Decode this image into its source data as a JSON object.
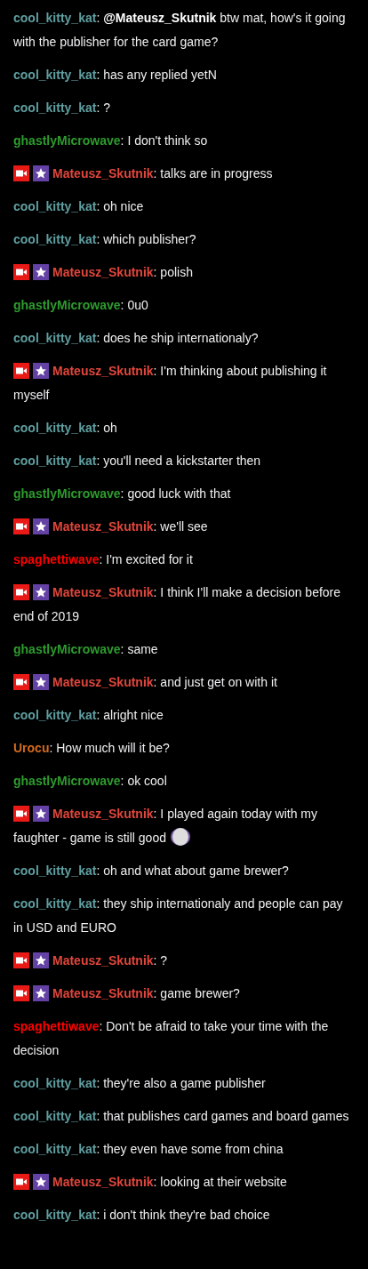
{
  "messages": [
    {
      "author": "cool_kitty_kat",
      "color": "#5f9ea0",
      "text": ": **@Mateusz_Skutnik** btw mat, how's it going with the publisher for the card game?"
    },
    {
      "author": "cool_kitty_kat",
      "color": "#5f9ea0",
      "text": ": has any replied yetN"
    },
    {
      "author": "cool_kitty_kat",
      "color": "#5f9ea0",
      "text": ": ?"
    },
    {
      "author": "ghastlyMicrowave",
      "color": "#2e9b2e",
      "text": ": I don't think so"
    },
    {
      "author": "Mateusz_Skutnik",
      "color": "#e0463c",
      "badges": [
        {
          "kind": "broadcaster"
        },
        {
          "kind": "star"
        }
      ],
      "text": ": talks are in progress"
    },
    {
      "author": "cool_kitty_kat",
      "color": "#5f9ea0",
      "text": ": oh nice"
    },
    {
      "author": "cool_kitty_kat",
      "color": "#5f9ea0",
      "text": ": which publisher?"
    },
    {
      "author": "Mateusz_Skutnik",
      "color": "#e0463c",
      "badges": [
        {
          "kind": "broadcaster"
        },
        {
          "kind": "star"
        }
      ],
      "text": ": polish"
    },
    {
      "author": "ghastlyMicrowave",
      "color": "#2e9b2e",
      "text": ": 0u0"
    },
    {
      "author": "cool_kitty_kat",
      "color": "#5f9ea0",
      "text": ": does he ship internationaly?"
    },
    {
      "author": "Mateusz_Skutnik",
      "color": "#e0463c",
      "badges": [
        {
          "kind": "broadcaster"
        },
        {
          "kind": "star"
        }
      ],
      "text": ": I'm thinking about publishing it myself"
    },
    {
      "author": "cool_kitty_kat",
      "color": "#5f9ea0",
      "text": ": oh"
    },
    {
      "author": "cool_kitty_kat",
      "color": "#5f9ea0",
      "text": ": you'll need a kickstarter then"
    },
    {
      "author": "ghastlyMicrowave",
      "color": "#2e9b2e",
      "text": ": good luck with that"
    },
    {
      "author": "Mateusz_Skutnik",
      "color": "#e0463c",
      "badges": [
        {
          "kind": "broadcaster"
        },
        {
          "kind": "star"
        }
      ],
      "text": ": we'll see"
    },
    {
      "author": "spaghettiwave",
      "color": "#ff0000",
      "text": ": I'm excited for it"
    },
    {
      "author": "Mateusz_Skutnik",
      "color": "#e0463c",
      "badges": [
        {
          "kind": "broadcaster"
        },
        {
          "kind": "star"
        }
      ],
      "text": ": I think I'll make a decision before end of 2019"
    },
    {
      "author": "ghastlyMicrowave",
      "color": "#2e9b2e",
      "text": ": same"
    },
    {
      "author": "Mateusz_Skutnik",
      "color": "#e0463c",
      "badges": [
        {
          "kind": "broadcaster"
        },
        {
          "kind": "star"
        }
      ],
      "text": ": and just get on with it"
    },
    {
      "author": "cool_kitty_kat",
      "color": "#5f9ea0",
      "text": ": alright nice"
    },
    {
      "author": "Urocu",
      "color": "#d2691e",
      "text": ": How much will it be?"
    },
    {
      "author": "ghastlyMicrowave",
      "color": "#2e9b2e",
      "text": ": ok cool"
    },
    {
      "author": "Mateusz_Skutnik",
      "color": "#e0463c",
      "badges": [
        {
          "kind": "broadcaster"
        },
        {
          "kind": "star"
        }
      ],
      "text": ": I played again today with my faughter - game is still good",
      "emote": true
    },
    {
      "author": "cool_kitty_kat",
      "color": "#5f9ea0",
      "text": ": oh and what about game brewer?"
    },
    {
      "author": "cool_kitty_kat",
      "color": "#5f9ea0",
      "text": ": they ship internationaly and people can pay in USD and EURO"
    },
    {
      "author": "Mateusz_Skutnik",
      "color": "#e0463c",
      "badges": [
        {
          "kind": "broadcaster"
        },
        {
          "kind": "star"
        }
      ],
      "text": ": ?"
    },
    {
      "author": "Mateusz_Skutnik",
      "color": "#e0463c",
      "badges": [
        {
          "kind": "broadcaster"
        },
        {
          "kind": "star"
        }
      ],
      "text": ": game brewer?"
    },
    {
      "author": "spaghettiwave",
      "color": "#ff0000",
      "text": ": Don't be afraid to take your time with the decision"
    },
    {
      "author": "cool_kitty_kat",
      "color": "#5f9ea0",
      "text": ": they're also a game publisher"
    },
    {
      "author": "cool_kitty_kat",
      "color": "#5f9ea0",
      "text": ": that publishes card games and board games"
    },
    {
      "author": "cool_kitty_kat",
      "color": "#5f9ea0",
      "text": ": they even have some from china"
    },
    {
      "author": "Mateusz_Skutnik",
      "color": "#e0463c",
      "badges": [
        {
          "kind": "broadcaster"
        },
        {
          "kind": "star"
        }
      ],
      "text": ": looking at their website"
    },
    {
      "author": "cool_kitty_kat",
      "color": "#5f9ea0",
      "text": ": i don't think they're bad choice"
    }
  ]
}
